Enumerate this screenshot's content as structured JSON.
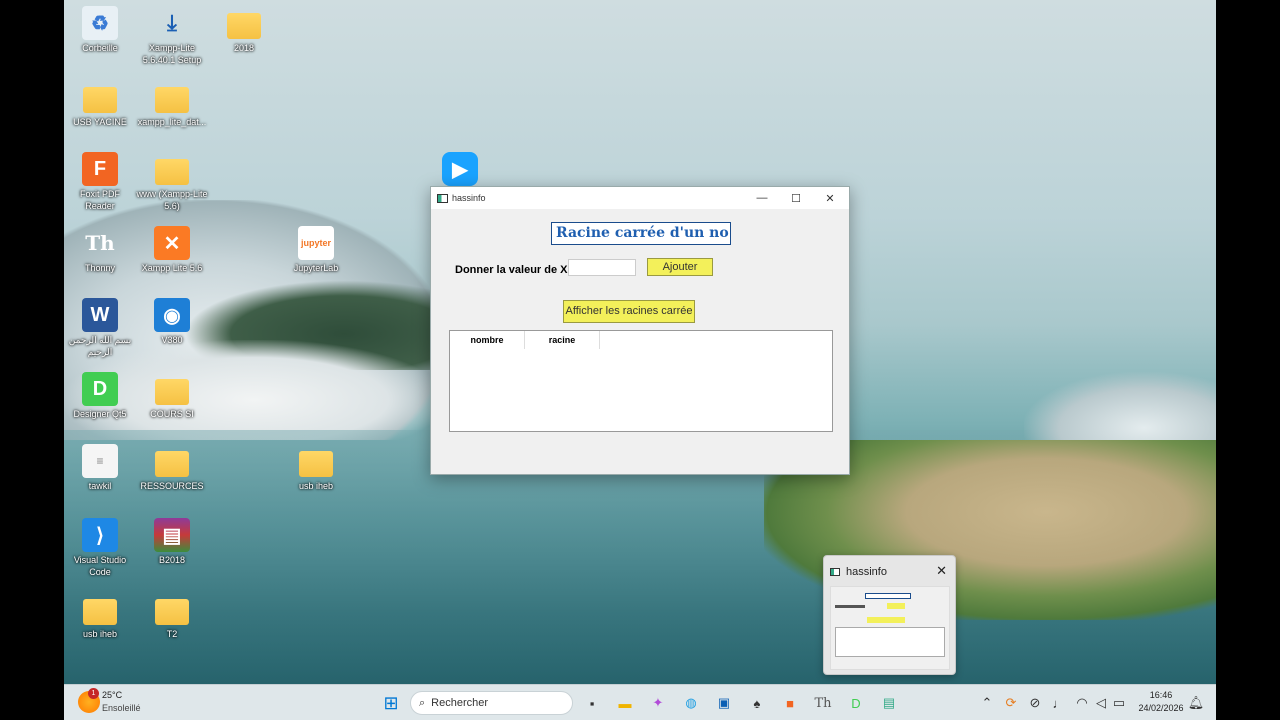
{
  "desktop_icons": [
    {
      "label": "Corbeille",
      "icon": "recycle-bin-icon"
    },
    {
      "label": "Xampp-Lite 5.6.40.1 Setup",
      "icon": "installer-icon"
    },
    {
      "label": "2018",
      "icon": "folder-icon"
    },
    {
      "label": "USB YACINE",
      "icon": "folder-icon"
    },
    {
      "label": "xampp_lite_dat...",
      "icon": "folder-icon"
    },
    {
      "label": "Foxit PDF Reader",
      "icon": "foxit-icon"
    },
    {
      "label": "www (Xampp-Lite 5.6)",
      "icon": "folder-shortcut-icon"
    },
    {
      "label": "Thonny",
      "icon": "thonny-icon"
    },
    {
      "label": "Xampp Lite 5.6",
      "icon": "xampp-icon"
    },
    {
      "label": "JupyterLab",
      "icon": "jupyter-icon"
    },
    {
      "label": "بسم الله الرحمن الرحيم",
      "icon": "word-icon"
    },
    {
      "label": "V380",
      "icon": "v380-icon"
    },
    {
      "label": "Designer Qt5",
      "icon": "designer-icon"
    },
    {
      "label": "COURS SI",
      "icon": "folder-icon"
    },
    {
      "label": "tawkil",
      "icon": "document-icon"
    },
    {
      "label": "RESSOURCES",
      "icon": "folder-icon"
    },
    {
      "label": "usb iheb",
      "icon": "folder-icon"
    },
    {
      "label": "Visual Studio Code",
      "icon": "vscode-icon"
    },
    {
      "label": "B2018",
      "icon": "winrar-icon"
    },
    {
      "label": "usb iheb",
      "icon": "folder-icon"
    },
    {
      "label": "T2",
      "icon": "folder-icon"
    }
  ],
  "window": {
    "title": "hassinfo",
    "heading": "Racine carrée d'un no",
    "input_label": "Donner la valeur de X",
    "input_value": "",
    "add_button": "Ajouter",
    "show_button": "Afficher les racines carrée",
    "table_headers": [
      "nombre",
      "racine"
    ]
  },
  "thumbnail": {
    "title": "hassinfo"
  },
  "taskbar": {
    "weather_temp": "25°C",
    "weather_desc": "Ensoleillé",
    "weather_badge": "1",
    "search_placeholder": "Rechercher",
    "time": "16:46",
    "date": "24/02/2026"
  },
  "colors": {
    "button_yellow": "#f3f05a",
    "heading_blue": "#1f5fb0"
  }
}
